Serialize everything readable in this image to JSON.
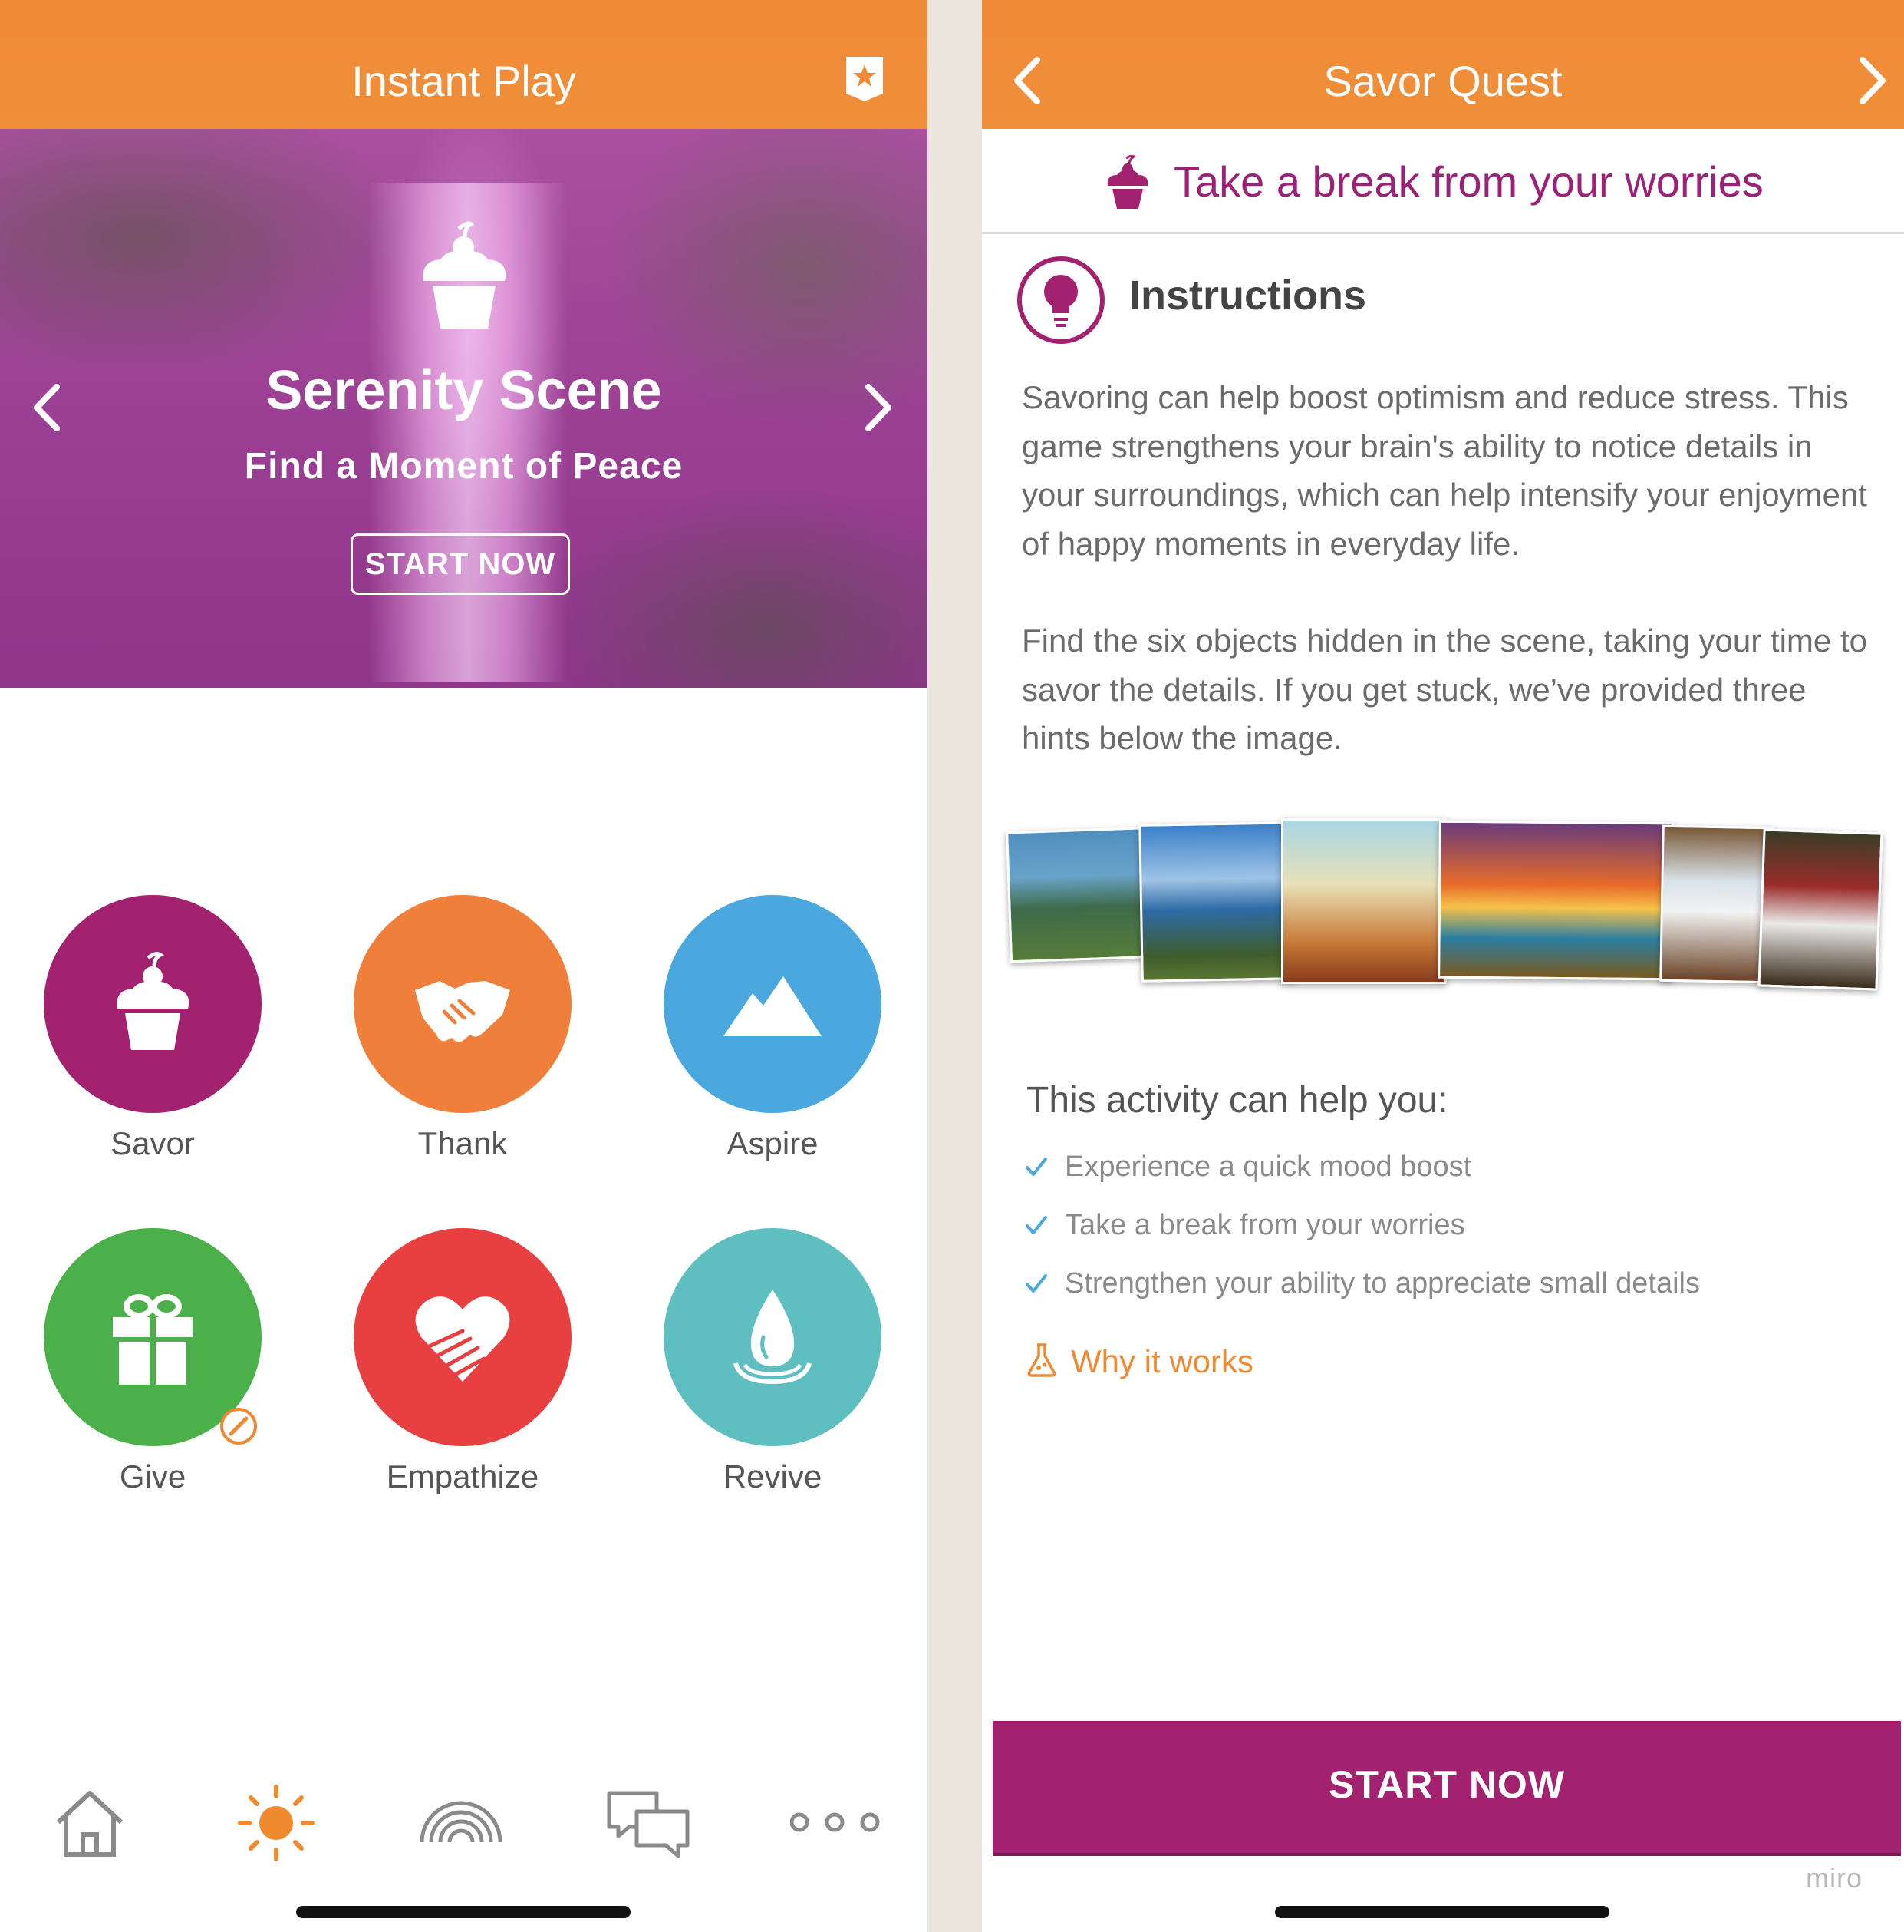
{
  "left": {
    "title": "Instant Play",
    "hero": {
      "title": "Serenity Scene",
      "subtitle": "Find a Moment of Peace",
      "button": "START NOW"
    },
    "categories": [
      {
        "label": "Savor",
        "color": "#a3226f",
        "icon": "cupcake-icon"
      },
      {
        "label": "Thank",
        "color": "#ef7f3a",
        "icon": "handshake-icon"
      },
      {
        "label": "Aspire",
        "color": "#4aa8df",
        "icon": "mountain-icon"
      },
      {
        "label": "Give",
        "color": "#4bb04a",
        "icon": "gift-icon"
      },
      {
        "label": "Empathize",
        "color": "#e84040",
        "icon": "heart-hand-icon"
      },
      {
        "label": "Revive",
        "color": "#5fbfc0",
        "icon": "water-drop-icon"
      }
    ],
    "bottom_nav": [
      "home-icon",
      "sun-icon",
      "rainbow-icon",
      "chat-icon",
      "more-icon"
    ],
    "active_nav_color": "#f08a2e"
  },
  "right": {
    "title": "Savor Quest",
    "subheading": "Take a break from your worries",
    "instructions_title": "Instructions",
    "paragraph1": "Savoring can help boost optimism and reduce stress. This game strengthens your brain's ability to notice details in your surroundings, which can help intensify your enjoyment of happy moments in everyday life.",
    "paragraph2": "Find the six objects hidden in the scene, taking your time to savor the details. If you get stuck, we’ve provided three hints below the image.",
    "help_title": "This activity can help you:",
    "benefits": [
      "Experience a quick mood boost",
      "Take a break from your worries",
      "Strengthen your ability to appreciate small details"
    ],
    "why_link": "Why it works",
    "start_button": "START NOW",
    "watermark": "miro"
  },
  "colors": {
    "header_orange": "#f08a36",
    "brand_purple": "#a3226f",
    "link_orange": "#ee8a33",
    "check_blue": "#4aa8df"
  }
}
